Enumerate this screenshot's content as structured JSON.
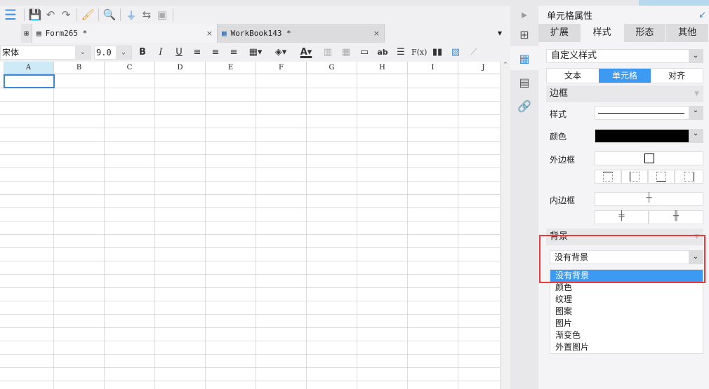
{
  "toolbar": {
    "icons": [
      "save-icon",
      "undo-icon",
      "redo-icon",
      "format-brush-icon",
      "preview-icon",
      "plug-icon",
      "swap-icon",
      "search-replace-icon"
    ]
  },
  "tabs": [
    {
      "label": "Form265 *",
      "active": true
    },
    {
      "label": "WorkBook143 *",
      "active": false
    }
  ],
  "format": {
    "font": "宋体",
    "size": "9.0",
    "bold": "B",
    "italic": "I",
    "underline": "U",
    "text_label": "ab",
    "formula": "F(x)"
  },
  "grid": {
    "columns": [
      "A",
      "B",
      "C",
      "D",
      "E",
      "F",
      "G",
      "H",
      "I",
      "J"
    ],
    "selected_column": "A"
  },
  "panel": {
    "title": "单元格属性",
    "tabs": [
      "扩展",
      "样式",
      "形态",
      "其他"
    ],
    "active_tab": "样式",
    "style_select": "自定义样式",
    "sub_tabs": [
      "文本",
      "单元格",
      "对齐"
    ],
    "active_sub_tab": "单元格",
    "border_section": "边框",
    "style_label": "样式",
    "color_label": "颜色",
    "outer_label": "外边框",
    "inner_label": "内边框",
    "border_color": "#000000",
    "background_section": "背景",
    "background_select": "没有背景",
    "background_options": [
      "没有背景",
      "颜色",
      "纹理",
      "图案",
      "图片",
      "渐变色",
      "外置图片"
    ],
    "selected_option": "没有背景"
  },
  "colors": {
    "accent": "#3d9af2",
    "highlight": "#f03a3a"
  }
}
